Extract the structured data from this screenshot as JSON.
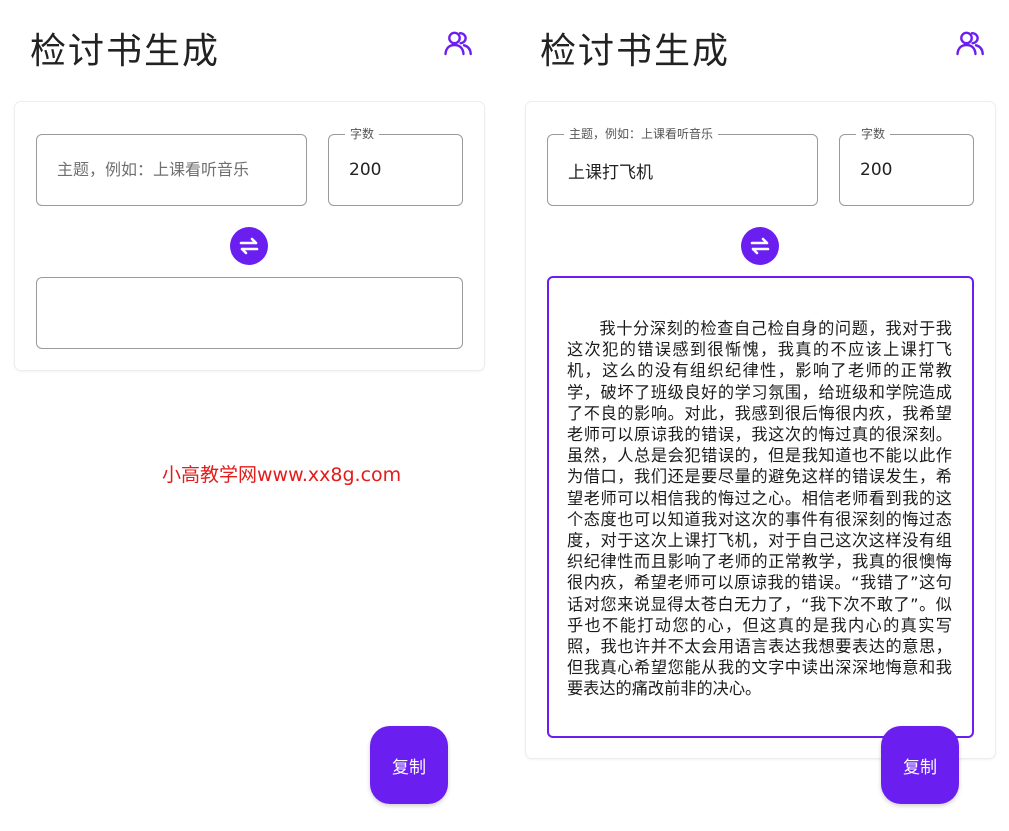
{
  "app": {
    "title": "检讨书生成"
  },
  "form": {
    "topic_placeholder": "主题，例如：上课看听音乐",
    "topic_label": "主题，例如：上课看听音乐",
    "word_count_label": "字数",
    "word_count_value": "200",
    "copy_label": "复制"
  },
  "left_screen": {
    "topic_value": "",
    "output_text": ""
  },
  "right_screen": {
    "topic_value": "上课打飞机",
    "output_text": "我十分深刻的检查自己检自身的问题，我对于我这次犯的错误感到很惭愧，我真的不应该上课打飞机，这么的没有组织纪律性，影响了老师的正常教学，破坏了班级良好的学习氛围，给班级和学院造成了不良的影响。对此，我感到很后悔很内疚，我希望老师可以原谅我的错误，我这次的悔过真的很深刻。虽然，人总是会犯错误的，但是我知道也不能以此作为借口，我们还是要尽量的避免这样的错误发生，希望老师可以相信我的悔过之心。相信老师看到我的这个态度也可以知道我对这次的事件有很深刻的悔过态度，对于这次上课打飞机，对于自己这次这样没有组织纪律性而且影响了老师的正常教学，我真的很懊悔很内疚，希望老师可以原谅我的错误。“我错了”这句话对您来说显得太苍白无力了，“我下次不敢了”。似乎也不能打动您的心，但这真的是我内心的真实写照，我也许并不太会用语言表达我想要表达的意思，但我真心希望您能从我的文字中读出深深地悔意和我要表达的痛改前非的决心。"
  },
  "watermark": "小高教学网www.xx8g.com",
  "icons": {
    "account": "people-icon",
    "swap": "swap-arrows-icon"
  },
  "colors": {
    "accent": "#6a1ef0",
    "watermark": "#e21b1b"
  }
}
